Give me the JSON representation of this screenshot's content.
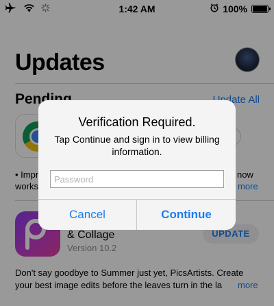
{
  "status_bar": {
    "time": "1:42 AM",
    "battery": "100%",
    "icons": [
      "airplane-icon",
      "wifi-icon",
      "activity-spinner-icon",
      "alarm-icon",
      "battery-icon"
    ]
  },
  "header": {
    "title": "Updates"
  },
  "pending": {
    "title": "Pending",
    "update_all": "Update All",
    "notes_line1": "• Impr",
    "notes_line1_right": "now",
    "notes_line2": "works",
    "more": "more"
  },
  "apps": [
    {
      "name_visible": "& Collage",
      "version": "Version 10.2",
      "action": "UPDATE",
      "description_line1": "Don't say goodbye to Summer just yet, PicsArtists. Create",
      "description_line2": "your best image edits before the leaves turn in the la",
      "more": "more"
    }
  ],
  "alert": {
    "title": "Verification Required.",
    "message": "Tap Continue and sign in to view billing information.",
    "password_placeholder": "Password",
    "password_value": "",
    "cancel": "Cancel",
    "continue": "Continue"
  },
  "colors": {
    "accent": "#1a7cf0",
    "overlay": "rgba(0,0,0,0.4)",
    "alert_background": "#f4f4f4"
  }
}
